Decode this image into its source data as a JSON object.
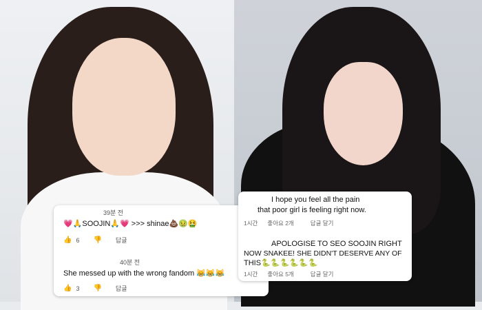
{
  "left_comments": [
    {
      "time": "39분 전",
      "text": "💗🙏SOOJIN🙏💗 >>> shinae💩🤢🤮",
      "likes": "6",
      "reply_label": "답글"
    },
    {
      "time": "40분 전",
      "text": "She messed up with the wrong fandom 😹😹😹",
      "likes": "3",
      "reply_label": "답글"
    }
  ],
  "right_comments": [
    {
      "text_line1": "I hope you feel all the pain",
      "text_line2": "that poor girl is feeling right now.",
      "time": "1시간",
      "likes": "좋아요 2개",
      "reply_label": "답글 달기"
    },
    {
      "text_line1": "APOLOGISE TO SEO SOOJIN RIGHT",
      "text_line2": "NOW SNAKEE! SHE DIDN'T DESERVE ANY OF",
      "text_line3": "THIS🐍🐍🐍🐍🐍🐍",
      "time": "1시간",
      "likes": "좋아요 5개",
      "reply_label": "답글 달기"
    }
  ],
  "colors": {
    "card_bg": "#ffffff",
    "text": "#111111",
    "meta": "#666666"
  },
  "icons": [
    "thumbs-up-icon",
    "thumbs-down-icon"
  ]
}
